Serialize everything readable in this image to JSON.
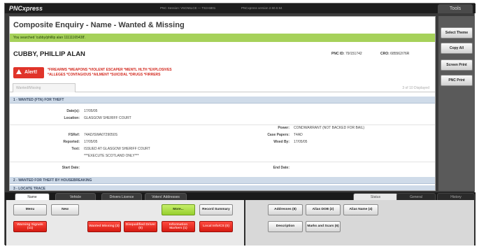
{
  "app": {
    "logo": "PNCxpress",
    "session": "PNC Session: V5CN6LCE — TS3-6801",
    "version": "PNCxpress version 2.50.0.94",
    "tools_tab": "Tools"
  },
  "page": {
    "title": "Composite Enquiry - Name - Wanted & Missing",
    "search_banner": "You searched 'cubby/phillip alan 11111165438'."
  },
  "subject": {
    "name": "CUBBY, PHILLIP ALAN",
    "pnc_id_label": "PNC ID:",
    "pnc_id": "79/151742",
    "cro_label": "CRO:",
    "cro": "685562/76R"
  },
  "alert": {
    "button_label": "Alert!",
    "line1": "*FIREARMS *WEAPONS *VIOLENT ESCAPER *MENTL HLTH *EXPLOSIVES",
    "line2": "*ALLEGES *CONTAGIOUS *AILMENT *SUICIDAL *DRUGS *FIRRERS"
  },
  "subtab": {
    "label": "Wanted/Missing",
    "displayed": "3 of 10 Displayed"
  },
  "records": [
    {
      "header": "1 - WANTED (FTA) FOR THEFT",
      "date_label": "Date(s):",
      "date": "17/05/05",
      "location_label": "Location:",
      "location": "GLASGOW SHERIFF COURT",
      "fsref_label": "FSRef:",
      "fsref": "74AD/SWA0729050S",
      "reported_label": "Reported:",
      "reported": "17/05/05",
      "text_label": "Text:",
      "text1": "ISSUED AT GLASGOW SHERIFF COURT",
      "text2": "***EXECUTE SCOTLAND ONLY***",
      "start_label": "Start Date:",
      "power_label": "Power:",
      "power": "CONDWARRANT (NOT BACKED FOR BAIL)",
      "case_label": "Case Papers:",
      "case": "T4AD",
      "wxed_label": "Wxed By:",
      "wxed": "17/05/05",
      "end_label": "End Date:"
    },
    {
      "header": "2 - WANTED FOR THEFT BY HOUSEBREAKING"
    },
    {
      "header": "3 - LOCATE TRACE"
    }
  ],
  "right_panel": {
    "buttons": [
      "Select Theme",
      "Copy All",
      "Screen Print",
      "PNC Print"
    ]
  },
  "bottom": {
    "tabs_left": [
      "Name",
      "Vehicle",
      "Drivers Licence",
      "Voters' Addresses"
    ],
    "tabs_right": [
      "Status",
      "General",
      "History"
    ],
    "menu": "Menu",
    "new": "New",
    "more": "More...",
    "record_summary": "Record Summary",
    "red_buttons": [
      "Warning Signals (11)",
      "Wanted Missing (3)",
      "Disqualified Driver (0)",
      "Information Markers (1)",
      "Local Info/CS (0)"
    ],
    "addresses": "Addresses (8)",
    "alias_dob": "Alias DOB (2)",
    "alias_name": "Alias Name (4)",
    "description": "Description",
    "marks_scars": "Marks and Scars (6)"
  }
}
